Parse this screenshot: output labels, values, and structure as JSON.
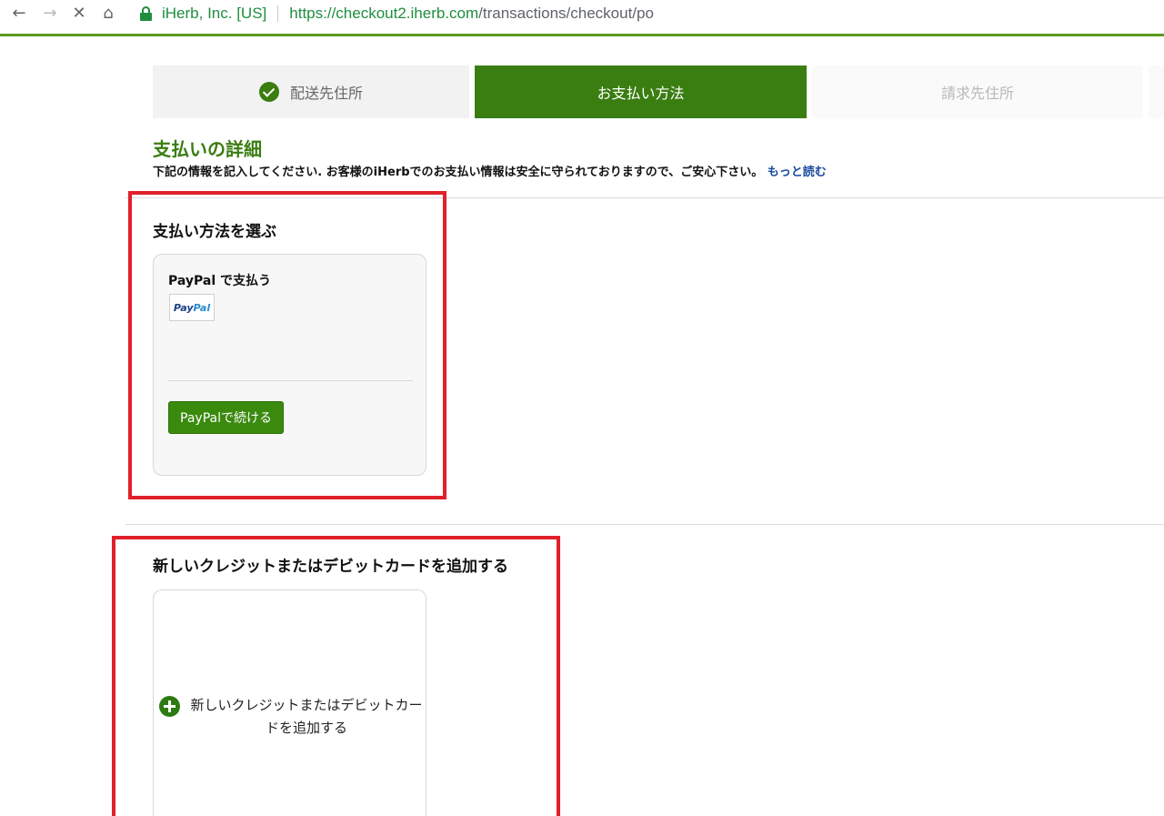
{
  "browser": {
    "site_name": "iHerb, Inc. [US]",
    "url_host": "https://checkout2.iherb.com",
    "url_path": "/transactions/checkout/po",
    "back_icon": "arrow-left-icon",
    "forward_icon": "arrow-right-icon",
    "stop_icon": "close-icon",
    "home_icon": "home-icon"
  },
  "steps": [
    {
      "label": "配送先住所",
      "state": "done"
    },
    {
      "label": "お支払い方法",
      "state": "active"
    },
    {
      "label": "請求先住所",
      "state": "upcoming"
    }
  ],
  "page": {
    "title": "支払いの詳細",
    "subtitle": "下記の情報を記入してください. お客様のiHerbでのお支払い情報は安全に守られておりますので、ご安心下さい。",
    "read_more": "もっと読む"
  },
  "payment": {
    "section_title": "支払い方法を選ぶ",
    "paypal": {
      "title": "PayPal で支払う",
      "logo_part1": "Pay",
      "logo_part2": "Pal",
      "button_label": "PayPalで続ける"
    }
  },
  "add_card": {
    "section_title": "新しいクレジットまたはデビットカードを追加する",
    "tile_label": "新しいクレジットまたはデビットカードを追加する"
  },
  "colors": {
    "brand_green": "#3a7d11",
    "highlight_red": "#e0202a",
    "link_blue": "#1a4aa0"
  }
}
